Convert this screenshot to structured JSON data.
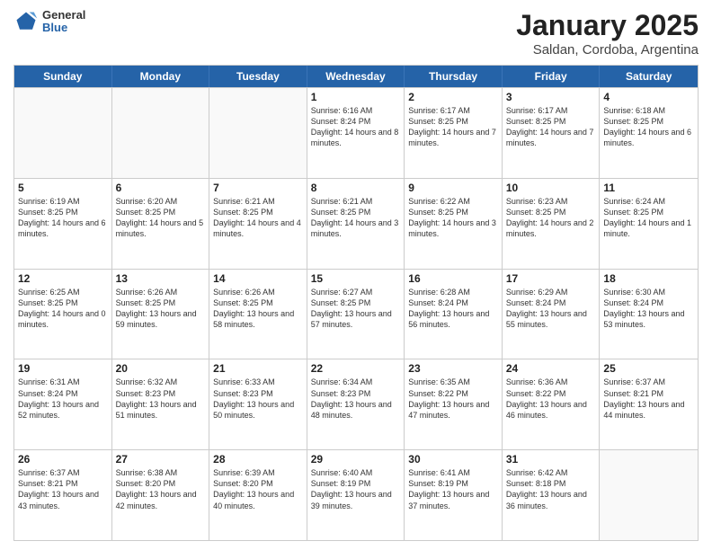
{
  "header": {
    "logo_general": "General",
    "logo_blue": "Blue",
    "month_year": "January 2025",
    "location": "Saldan, Cordoba, Argentina"
  },
  "weekdays": [
    "Sunday",
    "Monday",
    "Tuesday",
    "Wednesday",
    "Thursday",
    "Friday",
    "Saturday"
  ],
  "rows": [
    [
      {
        "day": "",
        "sunrise": "",
        "sunset": "",
        "daylight": ""
      },
      {
        "day": "",
        "sunrise": "",
        "sunset": "",
        "daylight": ""
      },
      {
        "day": "",
        "sunrise": "",
        "sunset": "",
        "daylight": ""
      },
      {
        "day": "1",
        "sunrise": "Sunrise: 6:16 AM",
        "sunset": "Sunset: 8:24 PM",
        "daylight": "Daylight: 14 hours and 8 minutes."
      },
      {
        "day": "2",
        "sunrise": "Sunrise: 6:17 AM",
        "sunset": "Sunset: 8:25 PM",
        "daylight": "Daylight: 14 hours and 7 minutes."
      },
      {
        "day": "3",
        "sunrise": "Sunrise: 6:17 AM",
        "sunset": "Sunset: 8:25 PM",
        "daylight": "Daylight: 14 hours and 7 minutes."
      },
      {
        "day": "4",
        "sunrise": "Sunrise: 6:18 AM",
        "sunset": "Sunset: 8:25 PM",
        "daylight": "Daylight: 14 hours and 6 minutes."
      }
    ],
    [
      {
        "day": "5",
        "sunrise": "Sunrise: 6:19 AM",
        "sunset": "Sunset: 8:25 PM",
        "daylight": "Daylight: 14 hours and 6 minutes."
      },
      {
        "day": "6",
        "sunrise": "Sunrise: 6:20 AM",
        "sunset": "Sunset: 8:25 PM",
        "daylight": "Daylight: 14 hours and 5 minutes."
      },
      {
        "day": "7",
        "sunrise": "Sunrise: 6:21 AM",
        "sunset": "Sunset: 8:25 PM",
        "daylight": "Daylight: 14 hours and 4 minutes."
      },
      {
        "day": "8",
        "sunrise": "Sunrise: 6:21 AM",
        "sunset": "Sunset: 8:25 PM",
        "daylight": "Daylight: 14 hours and 3 minutes."
      },
      {
        "day": "9",
        "sunrise": "Sunrise: 6:22 AM",
        "sunset": "Sunset: 8:25 PM",
        "daylight": "Daylight: 14 hours and 3 minutes."
      },
      {
        "day": "10",
        "sunrise": "Sunrise: 6:23 AM",
        "sunset": "Sunset: 8:25 PM",
        "daylight": "Daylight: 14 hours and 2 minutes."
      },
      {
        "day": "11",
        "sunrise": "Sunrise: 6:24 AM",
        "sunset": "Sunset: 8:25 PM",
        "daylight": "Daylight: 14 hours and 1 minute."
      }
    ],
    [
      {
        "day": "12",
        "sunrise": "Sunrise: 6:25 AM",
        "sunset": "Sunset: 8:25 PM",
        "daylight": "Daylight: 14 hours and 0 minutes."
      },
      {
        "day": "13",
        "sunrise": "Sunrise: 6:26 AM",
        "sunset": "Sunset: 8:25 PM",
        "daylight": "Daylight: 13 hours and 59 minutes."
      },
      {
        "day": "14",
        "sunrise": "Sunrise: 6:26 AM",
        "sunset": "Sunset: 8:25 PM",
        "daylight": "Daylight: 13 hours and 58 minutes."
      },
      {
        "day": "15",
        "sunrise": "Sunrise: 6:27 AM",
        "sunset": "Sunset: 8:25 PM",
        "daylight": "Daylight: 13 hours and 57 minutes."
      },
      {
        "day": "16",
        "sunrise": "Sunrise: 6:28 AM",
        "sunset": "Sunset: 8:24 PM",
        "daylight": "Daylight: 13 hours and 56 minutes."
      },
      {
        "day": "17",
        "sunrise": "Sunrise: 6:29 AM",
        "sunset": "Sunset: 8:24 PM",
        "daylight": "Daylight: 13 hours and 55 minutes."
      },
      {
        "day": "18",
        "sunrise": "Sunrise: 6:30 AM",
        "sunset": "Sunset: 8:24 PM",
        "daylight": "Daylight: 13 hours and 53 minutes."
      }
    ],
    [
      {
        "day": "19",
        "sunrise": "Sunrise: 6:31 AM",
        "sunset": "Sunset: 8:24 PM",
        "daylight": "Daylight: 13 hours and 52 minutes."
      },
      {
        "day": "20",
        "sunrise": "Sunrise: 6:32 AM",
        "sunset": "Sunset: 8:23 PM",
        "daylight": "Daylight: 13 hours and 51 minutes."
      },
      {
        "day": "21",
        "sunrise": "Sunrise: 6:33 AM",
        "sunset": "Sunset: 8:23 PM",
        "daylight": "Daylight: 13 hours and 50 minutes."
      },
      {
        "day": "22",
        "sunrise": "Sunrise: 6:34 AM",
        "sunset": "Sunset: 8:23 PM",
        "daylight": "Daylight: 13 hours and 48 minutes."
      },
      {
        "day": "23",
        "sunrise": "Sunrise: 6:35 AM",
        "sunset": "Sunset: 8:22 PM",
        "daylight": "Daylight: 13 hours and 47 minutes."
      },
      {
        "day": "24",
        "sunrise": "Sunrise: 6:36 AM",
        "sunset": "Sunset: 8:22 PM",
        "daylight": "Daylight: 13 hours and 46 minutes."
      },
      {
        "day": "25",
        "sunrise": "Sunrise: 6:37 AM",
        "sunset": "Sunset: 8:21 PM",
        "daylight": "Daylight: 13 hours and 44 minutes."
      }
    ],
    [
      {
        "day": "26",
        "sunrise": "Sunrise: 6:37 AM",
        "sunset": "Sunset: 8:21 PM",
        "daylight": "Daylight: 13 hours and 43 minutes."
      },
      {
        "day": "27",
        "sunrise": "Sunrise: 6:38 AM",
        "sunset": "Sunset: 8:20 PM",
        "daylight": "Daylight: 13 hours and 42 minutes."
      },
      {
        "day": "28",
        "sunrise": "Sunrise: 6:39 AM",
        "sunset": "Sunset: 8:20 PM",
        "daylight": "Daylight: 13 hours and 40 minutes."
      },
      {
        "day": "29",
        "sunrise": "Sunrise: 6:40 AM",
        "sunset": "Sunset: 8:19 PM",
        "daylight": "Daylight: 13 hours and 39 minutes."
      },
      {
        "day": "30",
        "sunrise": "Sunrise: 6:41 AM",
        "sunset": "Sunset: 8:19 PM",
        "daylight": "Daylight: 13 hours and 37 minutes."
      },
      {
        "day": "31",
        "sunrise": "Sunrise: 6:42 AM",
        "sunset": "Sunset: 8:18 PM",
        "daylight": "Daylight: 13 hours and 36 minutes."
      },
      {
        "day": "",
        "sunrise": "",
        "sunset": "",
        "daylight": ""
      }
    ]
  ]
}
